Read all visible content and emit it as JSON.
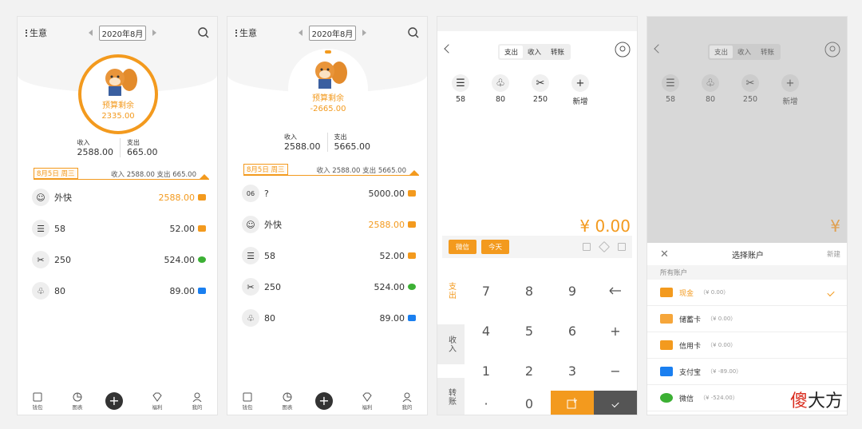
{
  "screen1": {
    "menu_title": "生意",
    "month": "2020年8月",
    "budget_label": "预算剩余",
    "budget_value": "2335.00",
    "income_label": "收入",
    "income_value": "2588.00",
    "expense_label": "支出",
    "expense_value": "665.00",
    "day_tag": "8月5日 周三",
    "day_summary": "收入 2588.00   支出 665.00",
    "transactions": [
      {
        "name": "外快",
        "amount": "2588.00",
        "type": "income",
        "pay": "cash"
      },
      {
        "name": "58",
        "amount": "52.00",
        "type": "expense",
        "pay": "cash"
      },
      {
        "name": "250",
        "amount": "524.00",
        "type": "expense",
        "pay": "wechat"
      },
      {
        "name": "80",
        "amount": "89.00",
        "type": "expense",
        "pay": "alipay"
      }
    ]
  },
  "screen2": {
    "menu_title": "生意",
    "month": "2020年8月",
    "budget_label": "预算剩余",
    "budget_value": "-2665.00",
    "income_label": "收入",
    "income_value": "2588.00",
    "expense_label": "支出",
    "expense_value": "5665.00",
    "day_tag": "8月5日 周三",
    "day_summary": "收入 2588.00   支出 5665.00",
    "transactions": [
      {
        "name": "?",
        "amount": "5000.00",
        "type": "expense",
        "pay": "cash"
      },
      {
        "name": "外快",
        "amount": "2588.00",
        "type": "income",
        "pay": "cash"
      },
      {
        "name": "58",
        "amount": "52.00",
        "type": "expense",
        "pay": "cash"
      },
      {
        "name": "250",
        "amount": "524.00",
        "type": "expense",
        "pay": "wechat"
      },
      {
        "name": "80",
        "amount": "89.00",
        "type": "expense",
        "pay": "alipay"
      }
    ]
  },
  "tabs": [
    "钱包",
    "图表",
    "福利",
    "我的"
  ],
  "entry": {
    "segments": [
      "支出",
      "收入",
      "转账"
    ],
    "categories": [
      "58",
      "80",
      "250",
      "新增"
    ],
    "amount": "¥ 0.00",
    "amount_partial": "¥",
    "account_btn": "微信",
    "date_btn": "今天",
    "modes": [
      "支出",
      "收入",
      "转账"
    ],
    "keys": [
      "7",
      "8",
      "9",
      "4",
      "5",
      "6",
      "+",
      "1",
      "2",
      "3",
      "−",
      "·",
      "0"
    ]
  },
  "sheet": {
    "title": "选择账户",
    "new": "新建",
    "section": "所有账户",
    "accounts": [
      {
        "name": "现金",
        "balance": "（¥ 0.00）"
      },
      {
        "name": "储蓄卡",
        "balance": "（¥ 0.00）"
      },
      {
        "name": "信用卡",
        "balance": "（¥ 0.00）"
      },
      {
        "name": "支付宝",
        "balance": "（¥ -89.00）"
      },
      {
        "name": "微信",
        "balance": "（¥ -524.00）"
      }
    ]
  },
  "watermark": {
    "w1": "傻",
    "w2": "大方"
  },
  "colors": {
    "accent": "#f39a1e",
    "wechat": "#3cb034",
    "alipay": "#1a7ff0"
  }
}
